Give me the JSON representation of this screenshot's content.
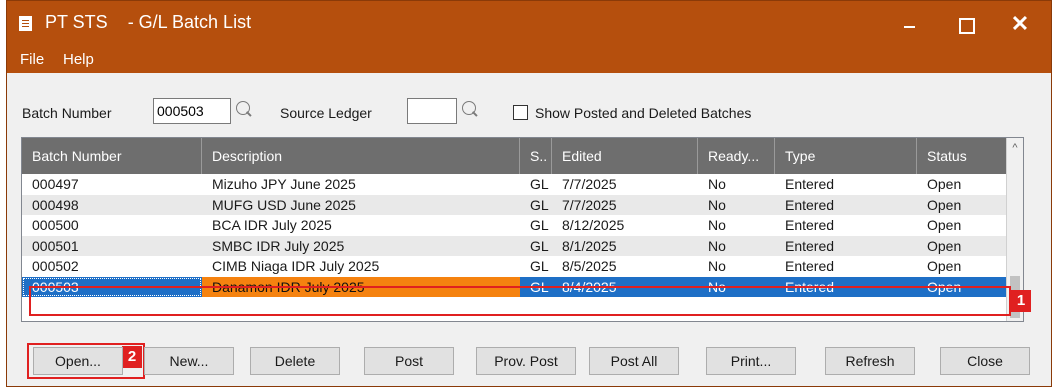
{
  "window": {
    "title": "PT STS    - G/L Batch List",
    "controls": {
      "minimize": "",
      "maximize": "",
      "close": "✕"
    }
  },
  "menu": {
    "items": [
      "File",
      "Help"
    ]
  },
  "filters": {
    "batch_number_label": "Batch Number",
    "batch_number_value": "000503",
    "source_ledger_label": "Source Ledger",
    "source_ledger_value": "",
    "show_posted_label": "Show Posted and Deleted Batches",
    "show_posted_checked": false
  },
  "grid": {
    "columns": [
      "Batch Number",
      "Description",
      "S..",
      "Edited",
      "Ready...",
      "Type",
      "Status"
    ],
    "rows": [
      [
        "000497",
        "Mizuho JPY June 2025",
        "GL",
        "7/7/2025",
        "No",
        "Entered",
        "Open"
      ],
      [
        "000498",
        "MUFG USD June 2025",
        "GL",
        "7/7/2025",
        "No",
        "Entered",
        "Open"
      ],
      [
        "000500",
        "BCA IDR July 2025",
        "GL",
        "8/12/2025",
        "No",
        "Entered",
        "Open"
      ],
      [
        "000501",
        "SMBC IDR July 2025",
        "GL",
        "8/1/2025",
        "No",
        "Entered",
        "Open"
      ],
      [
        "000502",
        "CIMB Niaga IDR July 2025",
        "GL",
        "8/5/2025",
        "No",
        "Entered",
        "Open"
      ],
      [
        "000503",
        "Danamon IDR July 2025",
        "GL",
        "8/4/2025",
        "No",
        "Entered",
        "Open"
      ]
    ],
    "selected_row": 5,
    "scroll_up_arrow": "^"
  },
  "annotations": {
    "row_marker": "1",
    "button_marker": "2",
    "color": "#e02020"
  },
  "buttons": [
    "Open...",
    "New...",
    "Delete",
    "Post",
    "Prov. Post",
    "Post All",
    "Print...",
    "Refresh",
    "Close"
  ],
  "colors": {
    "title_bar": "#b54f0d",
    "header": "#6e6e6e",
    "selection": "#1e6fc6",
    "selected_description": "#f5820f"
  },
  "icons": {
    "app": "list-document-icon",
    "finder": "magnifier-icon",
    "minimize": "minimize-icon",
    "maximize": "maximize-icon",
    "close": "close-icon"
  }
}
